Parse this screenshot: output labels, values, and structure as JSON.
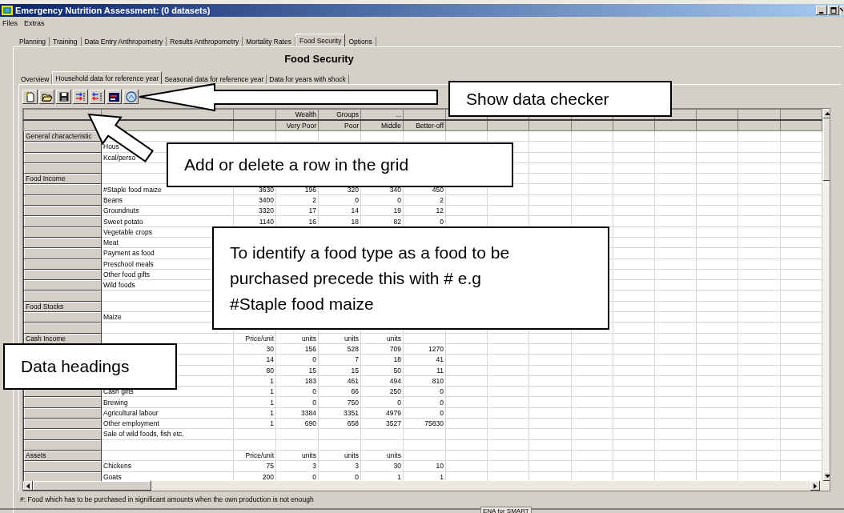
{
  "window": {
    "title": "Emergency Nutrition Assessment: (0 datasets)"
  },
  "menu": [
    "Files",
    "Extras"
  ],
  "tabs": [
    {
      "label": "Planning",
      "selected": false
    },
    {
      "label": "Training",
      "selected": false
    },
    {
      "label": "Data Entry Anthropometry",
      "selected": false
    },
    {
      "label": "Results Anthropometry",
      "selected": false
    },
    {
      "label": "Mortality Rates",
      "selected": false
    },
    {
      "label": "Food Security",
      "selected": true
    },
    {
      "label": "Options",
      "selected": false
    }
  ],
  "page_title": "Food Security",
  "subtabs": [
    {
      "label": "Overview",
      "selected": false
    },
    {
      "label": "Household data for reference year",
      "selected": true
    },
    {
      "label": "Seasonal data for reference year",
      "selected": false
    },
    {
      "label": "Data for years with shock",
      "selected": false
    }
  ],
  "grid": {
    "value_columns": [
      {
        "group": "Wealth",
        "heading": "Very Poor"
      },
      {
        "group": "Groups",
        "heading": "Poor"
      },
      {
        "group": "...",
        "heading": "Middle"
      },
      {
        "heading": "Better-off"
      }
    ],
    "rows": [
      {
        "kind": "section",
        "heading": "General characteristic"
      },
      {
        "kind": "item",
        "label": "Hous"
      },
      {
        "kind": "item",
        "label": "Kcal/perso"
      },
      {
        "kind": "blank"
      },
      {
        "kind": "section",
        "heading": "Food Income"
      },
      {
        "kind": "item",
        "label": "#Staple food maize",
        "cells": [
          "3630",
          "196",
          "320",
          "340",
          "450"
        ]
      },
      {
        "kind": "item",
        "label": "Beans",
        "cells": [
          "3400",
          "2",
          "0",
          "0",
          "2"
        ]
      },
      {
        "kind": "item",
        "label": "Groundnuts",
        "cells": [
          "3320",
          "17",
          "14",
          "19",
          "12"
        ]
      },
      {
        "kind": "item",
        "label": "Sweet potato",
        "cells": [
          "1140",
          "16",
          "18",
          "82",
          "0"
        ]
      },
      {
        "kind": "item",
        "label": "Vegetable crops"
      },
      {
        "kind": "item",
        "label": "Meat"
      },
      {
        "kind": "item",
        "label": "Payment as food"
      },
      {
        "kind": "item",
        "label": "Preschool meals"
      },
      {
        "kind": "item",
        "label": "Other food gifts"
      },
      {
        "kind": "item",
        "label": "Wild foods"
      },
      {
        "kind": "blank"
      },
      {
        "kind": "section",
        "heading": "Food Stocks"
      },
      {
        "kind": "item",
        "label": "Maize"
      },
      {
        "kind": "blank"
      },
      {
        "kind": "section",
        "heading": "Cash Income",
        "cells": [
          "Price/unit",
          "units",
          "units",
          "units"
        ]
      },
      {
        "kind": "item",
        "cells": [
          "30",
          "156",
          "528",
          "709",
          "1270"
        ]
      },
      {
        "kind": "item",
        "cells": [
          "14",
          "0",
          "7",
          "18",
          "41"
        ]
      },
      {
        "kind": "item",
        "cells": [
          "80",
          "15",
          "15",
          "50",
          "11"
        ]
      },
      {
        "kind": "item",
        "cells": [
          "1",
          "183",
          "461",
          "494",
          "810"
        ]
      },
      {
        "kind": "item",
        "label": "Cash gifts",
        "cells": [
          "1",
          "0",
          "66",
          "250",
          "0"
        ]
      },
      {
        "kind": "item",
        "label": "Brewing",
        "cells": [
          "1",
          "0",
          "750",
          "0",
          "0"
        ]
      },
      {
        "kind": "item",
        "label": "Agricultural labour",
        "cells": [
          "1",
          "3384",
          "3351",
          "4979",
          "0"
        ]
      },
      {
        "kind": "item",
        "label": "Other employment",
        "cells": [
          "1",
          "690",
          "658",
          "3527",
          "75830"
        ]
      },
      {
        "kind": "item",
        "label": "Sale of wild foods, fish etc."
      },
      {
        "kind": "blank"
      },
      {
        "kind": "section",
        "heading": "Assets",
        "cells": [
          "Price/unit",
          "units",
          "units",
          "units"
        ]
      },
      {
        "kind": "item",
        "label": "Chickens",
        "cells": [
          "75",
          "3",
          "3",
          "30",
          "10"
        ]
      },
      {
        "kind": "item",
        "label": "Goats",
        "cells": [
          "200",
          "0",
          "0",
          "1",
          "1"
        ]
      }
    ]
  },
  "footnote": "#: Food which has to be purchased in significant amounts when the own production is not enough",
  "status_bar": "ENA for SMART",
  "callouts": [
    {
      "text": "Show data checker"
    },
    {
      "text": "Add or delete a row in the grid"
    },
    {
      "text": "To identify a food type as a food to be\npurchased precede this with # e.g\n#Staple food maize"
    },
    {
      "text": "Data headings"
    }
  ]
}
